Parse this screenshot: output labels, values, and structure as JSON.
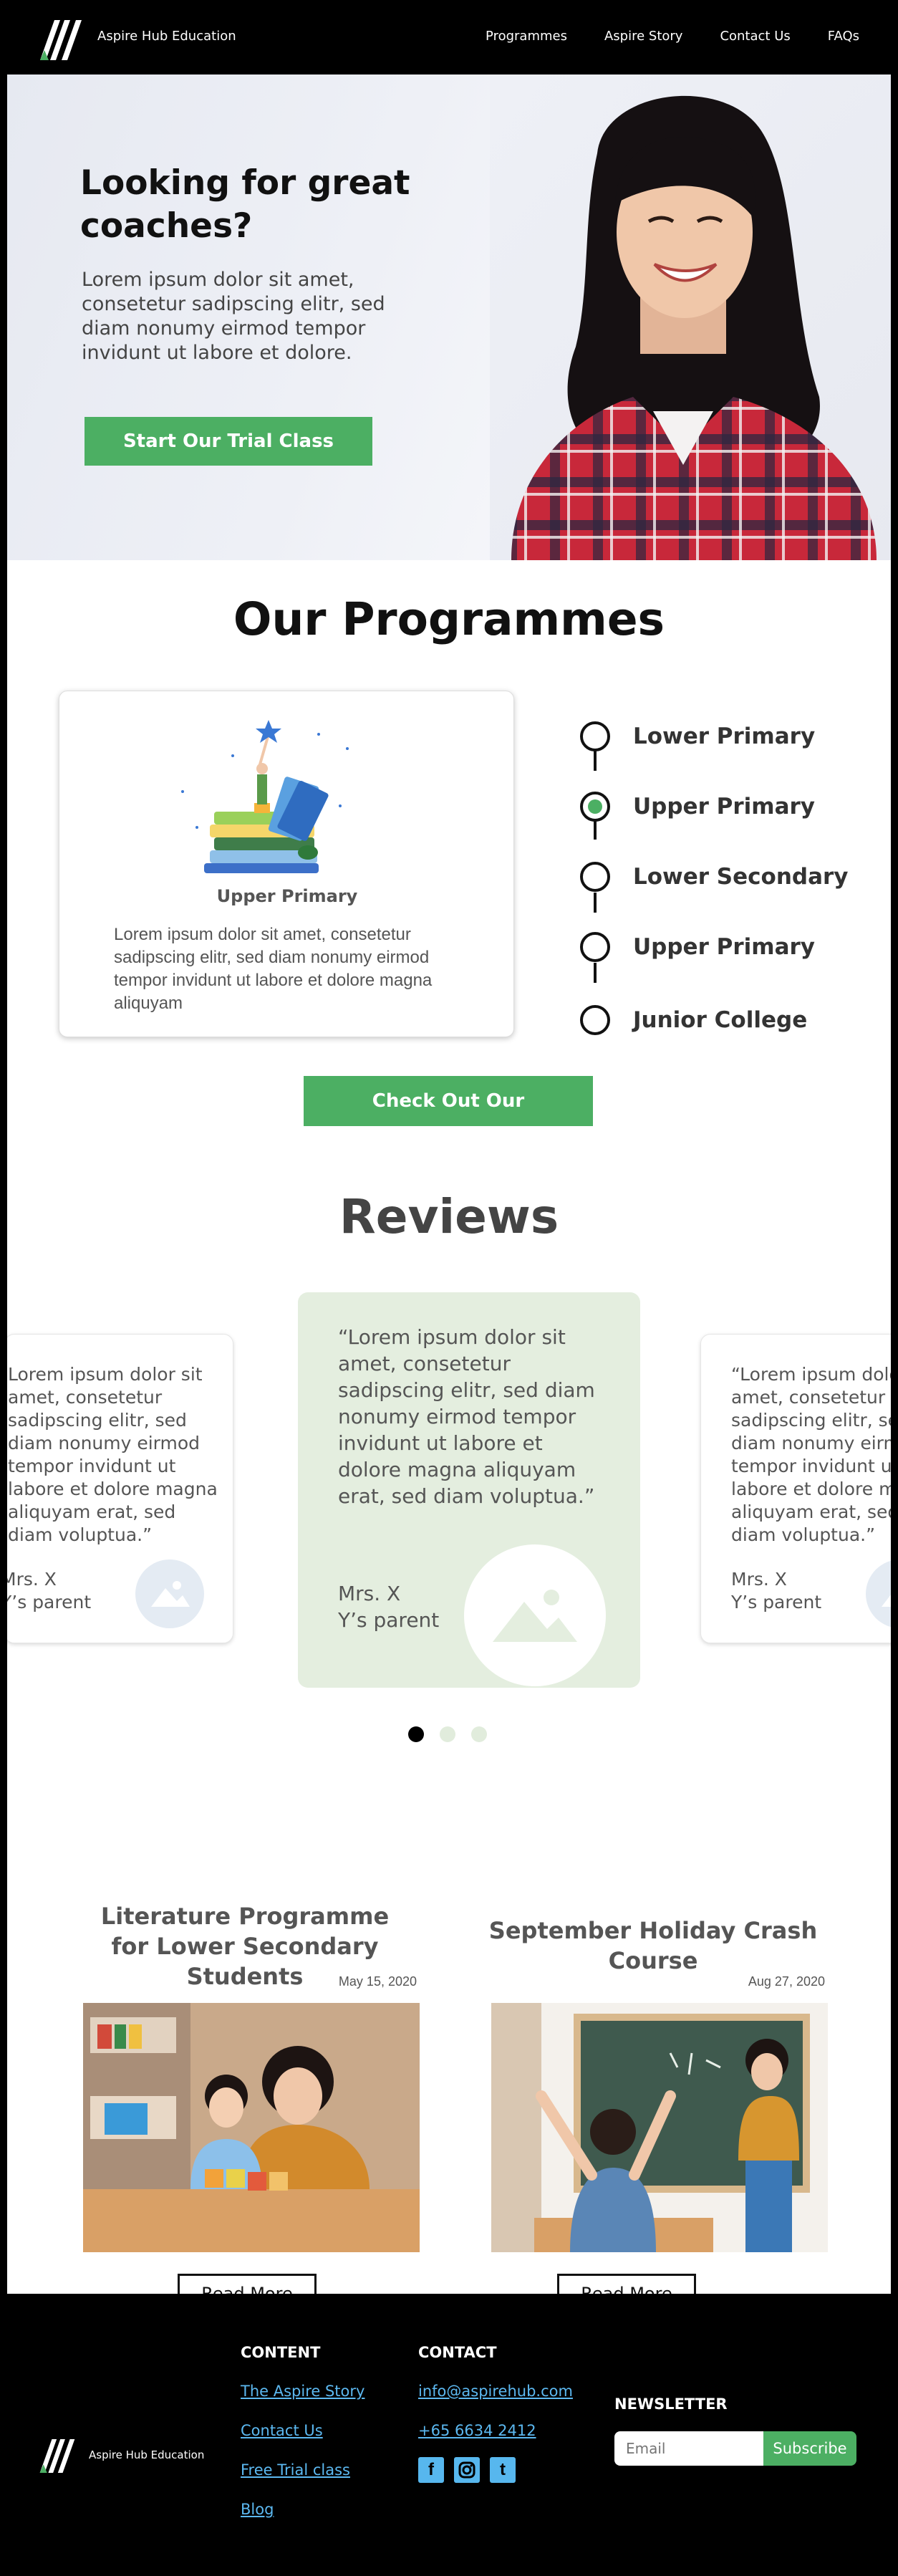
{
  "nav": {
    "brand": "Aspire Hub Education",
    "links": [
      "Programmes",
      "Aspire Story",
      "Contact Us",
      "FAQs"
    ]
  },
  "hero": {
    "title": "Looking for great coaches?",
    "body": "Lorem ipsum dolor sit amet, consetetur sadipscing elitr, sed diam nonumy eirmod tempor invidunt ut labore et dolore.",
    "cta": "Start Our Trial Class"
  },
  "programmes": {
    "title": "Our Programmes",
    "card_caption": "Upper Primary",
    "card_body": "Lorem ipsum dolor sit amet, consetetur sadipscing elitr, sed diam nonumy eirmod tempor invidunt ut labore et dolore magna aliquyam",
    "items": [
      "Lower Primary",
      "Upper Primary",
      "Lower Secondary",
      "Upper Primary",
      "Junior College"
    ],
    "active_index": 1,
    "cta": "Check Out Our Programmes"
  },
  "reviews": {
    "title": "Reviews",
    "items": [
      {
        "quote": "Lorem ipsum dolor sit amet, consetetur sadipscing elitr, sed diam nonumy eirmod tempor invidunt ut labore et dolore magna aliquyam erat, sed diam voluptua.”",
        "author_line1": "Mrs. X",
        "author_line2": "Y’s parent"
      },
      {
        "quote": "“Lorem ipsum dolor sit amet, consetetur sadipscing elitr, sed diam nonumy eirmod tempor invidunt ut labore et dolore magna aliquyam erat, sed diam voluptua.”",
        "author_line1": "Mrs. X",
        "author_line2": "Y’s parent"
      },
      {
        "quote": "“Lorem ipsum dolor sit amet, consetetur sadipscing elitr, sed diam nonumy eirmod tempor invidunt ut labore et dolore magna aliquyam erat, sed diam voluptua.”",
        "author_line1": "Mrs. X",
        "author_line2": "Y’s parent"
      }
    ],
    "active_dot": 0,
    "dot_count": 3
  },
  "articles": [
    {
      "title_line1": "Literature Programme",
      "title_line2": "for Lower Secondary Students",
      "date": "May 15, 2020",
      "cta": "Read More"
    },
    {
      "title_line1": "September Holiday Crash Course",
      "title_line2": "",
      "date": "Aug 27, 2020",
      "cta": "Read More"
    }
  ],
  "footer": {
    "brand": "Aspire Hub Education",
    "content_heading": "CONTENT",
    "content_links": [
      "The Aspire Story",
      "Contact Us",
      "Free Trial class",
      "Blog"
    ],
    "contact_heading": "CONTACT",
    "email": "info@aspirehub.com",
    "phone": "+65 6634 2412",
    "social_icons": [
      "facebook-icon",
      "instagram-icon",
      "tumblr-icon"
    ],
    "newsletter_heading": "NEWSLETTER",
    "newsletter_placeholder": "Email",
    "newsletter_button": "Subscribe"
  },
  "colors": {
    "accent_green": "#4caf63",
    "review_bg": "#e4eedf",
    "link_blue": "#5cb8f0"
  }
}
